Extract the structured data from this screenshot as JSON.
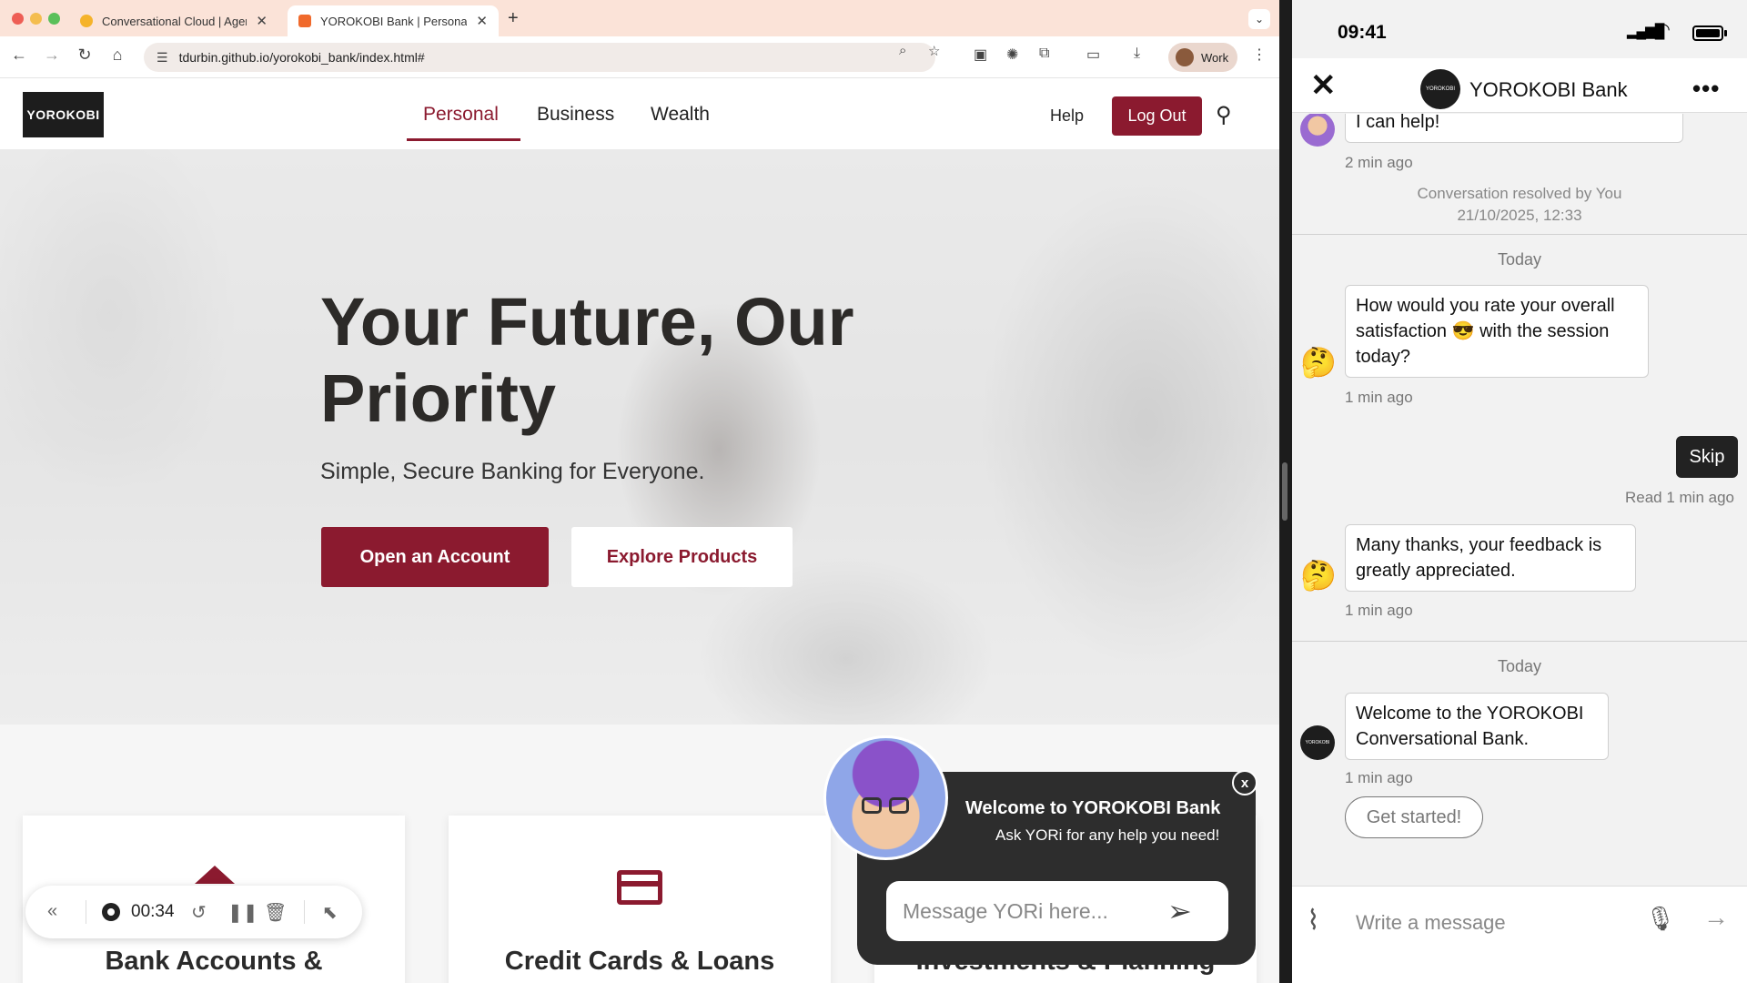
{
  "browser": {
    "tabs": [
      {
        "label": "Conversational Cloud | Agent",
        "favicon_color": "#f5b32a"
      },
      {
        "label": "YOROKOBI Bank | Personal B",
        "favicon_color": "#f06a2c"
      }
    ],
    "new_tab": "+",
    "tab_menu": "⌄",
    "url": "tdurbin.github.io/yorokobi_bank/index.html#",
    "profile_label": "Work"
  },
  "site": {
    "logo": "YOROKOBI",
    "nav": {
      "personal": "Personal",
      "business": "Business",
      "wealth": "Wealth"
    },
    "help": "Help",
    "logout": "Log Out",
    "brand_color": "#8b1a2f",
    "hero": {
      "title": "Your Future, Our Priority",
      "subtitle": "Simple, Secure Banking for Everyone.",
      "open_account": "Open an Account",
      "explore_products": "Explore Products"
    },
    "products": [
      {
        "title": "Bank Accounts &",
        "icon": "bank-icon"
      },
      {
        "title": "Credit Cards & Loans",
        "icon": "credit-card-icon"
      },
      {
        "title": "Investments & Planning",
        "icon": "chart-icon"
      }
    ]
  },
  "recorder": {
    "time": "00:34"
  },
  "yori": {
    "title": "Welcome to YOROKOBI Bank",
    "subtitle": "Ask YORi for any help you need!",
    "placeholder": "Message YORi here...",
    "close": "x"
  },
  "phone": {
    "time": "09:41",
    "header_title": "YOROKOBI Bank",
    "header_logo": "YOROKOBI",
    "messages": {
      "m1_text": "I can help!",
      "m1_time": "2 min ago",
      "resolved_1": "Conversation resolved by You",
      "resolved_2": "21/10/2025, 12:33",
      "day1": "Today",
      "m2_text": "How would you rate your overall satisfaction 😎 with the session today?",
      "m2_time": "1 min ago",
      "m3_text": "Skip",
      "m3_status": "Read 1 min ago",
      "m4_text": "Many thanks, your feedback is greatly appreciated.",
      "m4_time": "1 min ago",
      "day2": "Today",
      "m5_text": "Welcome to the YOROKOBI Conversational Bank.",
      "m5_time": "1 min ago",
      "quick_reply": "Get started!"
    },
    "avatar_emoji": "🤔",
    "compose_placeholder": "Write a message"
  }
}
